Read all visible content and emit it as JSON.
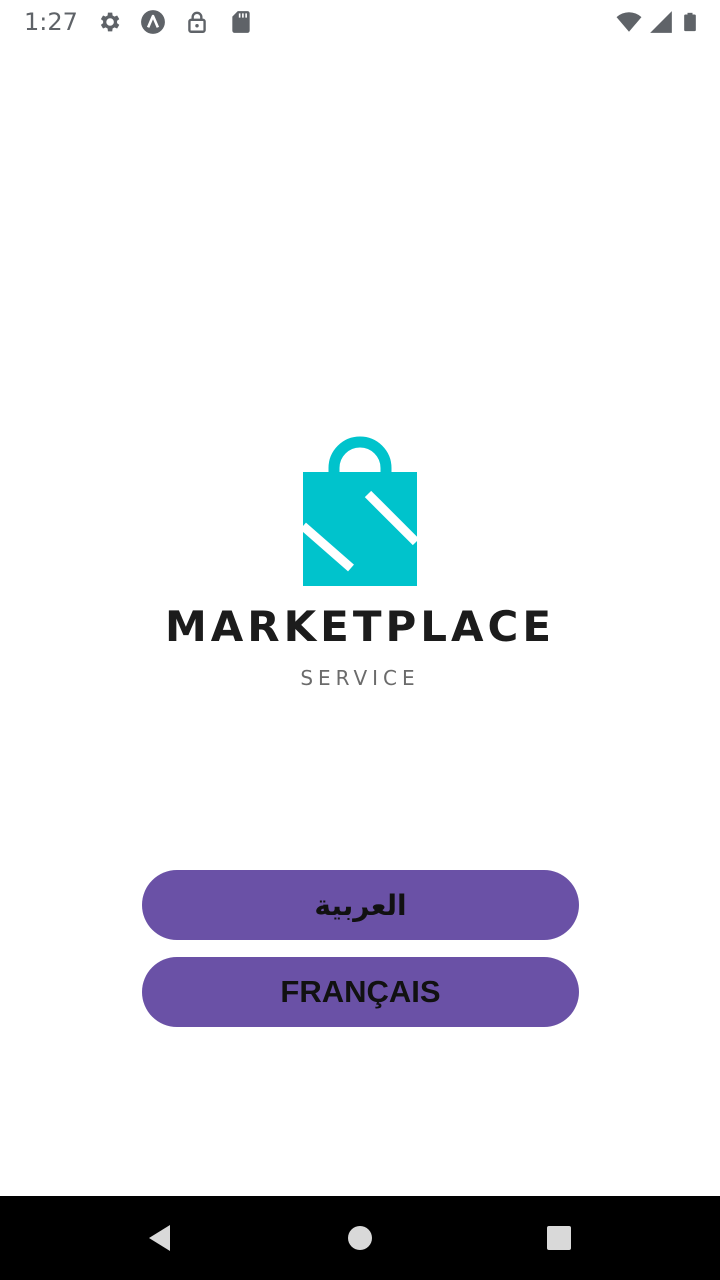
{
  "status_bar": {
    "time": "1:27",
    "left_icons": [
      "gear-icon",
      "android-a-icon",
      "lock-icon",
      "sd-card-icon"
    ],
    "right_icons": [
      "wifi-icon",
      "cellular-signal-icon",
      "battery-icon"
    ]
  },
  "logo": {
    "title": "MARKETPLACE",
    "subtitle": "SERVICE",
    "bag_color": "#00c3cc"
  },
  "language_buttons": {
    "arabic_label": "العربية",
    "french_label": "FRANÇAIS",
    "button_color": "#6a51a6"
  },
  "nav_bar": {
    "icons": [
      "back-icon",
      "home-icon",
      "recents-icon"
    ]
  }
}
